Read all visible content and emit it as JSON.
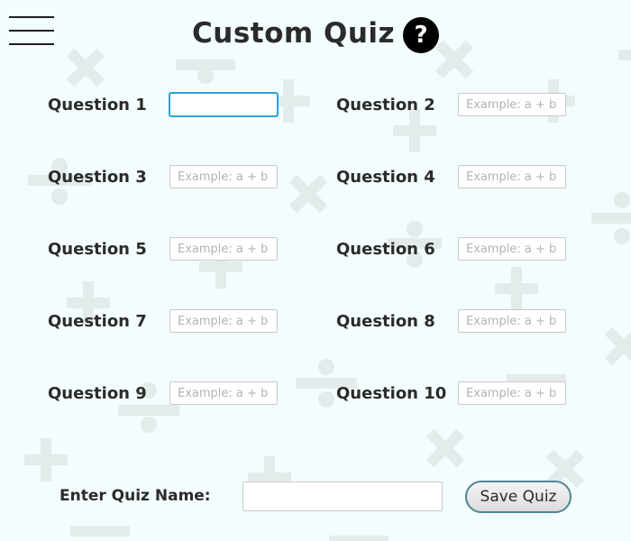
{
  "header": {
    "title": "Custom Quiz",
    "help_label": "?",
    "menu_icon": "hamburger-menu-icon",
    "help_icon": "question-mark-icon"
  },
  "questions": [
    {
      "label": "Question 1",
      "value": "",
      "placeholder": ""
    },
    {
      "label": "Question 2",
      "value": "",
      "placeholder": "Example: a + b"
    },
    {
      "label": "Question 3",
      "value": "",
      "placeholder": "Example: a + b"
    },
    {
      "label": "Question 4",
      "value": "",
      "placeholder": "Example: a + b"
    },
    {
      "label": "Question 5",
      "value": "",
      "placeholder": "Example: a + b"
    },
    {
      "label": "Question 6",
      "value": "",
      "placeholder": "Example: a + b"
    },
    {
      "label": "Question 7",
      "value": "",
      "placeholder": "Example: a + b"
    },
    {
      "label": "Question 8",
      "value": "",
      "placeholder": "Example: a + b"
    },
    {
      "label": "Question 9",
      "value": "",
      "placeholder": "Example: a + b"
    },
    {
      "label": "Question 10",
      "value": "",
      "placeholder": "Example: a + b"
    }
  ],
  "quiz_name": {
    "label": "Enter Quiz Name:",
    "value": "",
    "placeholder": ""
  },
  "save": {
    "label": "Save Quiz"
  },
  "colors": {
    "background": "#f3fdfd",
    "focus_ring": "#2aa3d9",
    "button_border": "#4e8694",
    "background_symbols": "#e3ebeb"
  }
}
